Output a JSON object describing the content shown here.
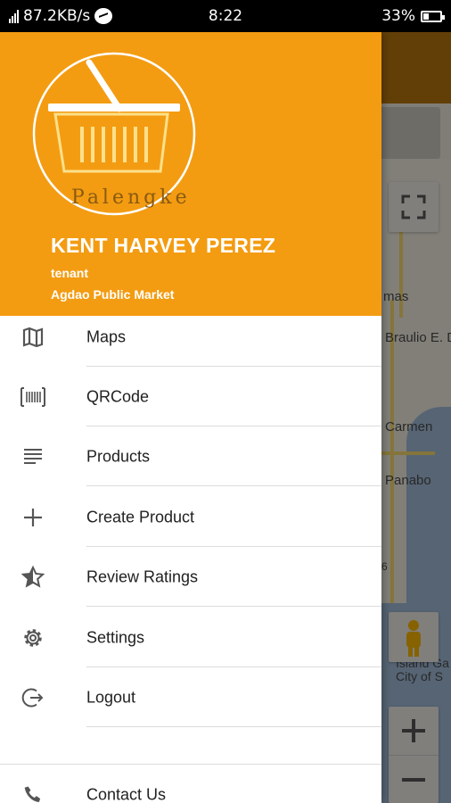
{
  "status_bar": {
    "network_speed": "87.2KB/s",
    "time": "8:22",
    "battery": "33%"
  },
  "drawer": {
    "logo_text": "Palengke",
    "user_name": "KENT HARVEY PEREZ",
    "user_role": "tenant",
    "market": "Agdao Public Market",
    "menu": [
      {
        "label": "Maps",
        "icon": "map-icon"
      },
      {
        "label": "QRCode",
        "icon": "barcode-icon"
      },
      {
        "label": "Products",
        "icon": "list-icon"
      },
      {
        "label": "Create Product",
        "icon": "plus-icon"
      },
      {
        "label": "Review Ratings",
        "icon": "star-half-icon"
      },
      {
        "label": "Settings",
        "icon": "gear-icon"
      },
      {
        "label": "Logout",
        "icon": "logout-icon"
      }
    ],
    "footer_item": {
      "label": "Contact Us",
      "icon": "phone-icon"
    }
  },
  "map": {
    "labels": [
      "mas",
      "Braulio E. Duja",
      "Carmen",
      "Panabo",
      "6",
      "Island Ga City of S"
    ]
  },
  "colors": {
    "header": "#f39c12",
    "accent": "#f39c12"
  }
}
